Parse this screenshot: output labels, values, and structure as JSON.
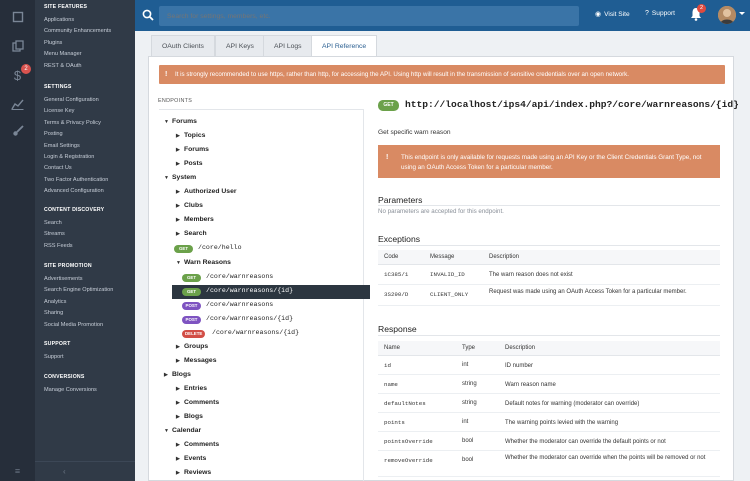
{
  "rail": {
    "icons": [
      "square-icon",
      "copy-icon",
      "dollar-icon",
      "chart-icon",
      "brush-icon"
    ],
    "badge": "2"
  },
  "menu": {
    "sections": [
      {
        "heading": "SITE FEATURES",
        "links": [
          "Applications",
          "Community Enhancements",
          "Plugins",
          "Menu Manager",
          "REST & OAuth"
        ]
      },
      {
        "heading": "SETTINGS",
        "links": [
          "General Configuration",
          "License Key",
          "Terms & Privacy Policy",
          "Posting",
          "Email Settings",
          "Login & Registration",
          "Contact Us",
          "Two Factor Authentication",
          "Advanced Configuration"
        ]
      },
      {
        "heading": "CONTENT DISCOVERY",
        "links": [
          "Search",
          "Streams",
          "RSS Feeds"
        ]
      },
      {
        "heading": "SITE PROMOTION",
        "links": [
          "Advertisements",
          "Search Engine Optimization",
          "Analytics",
          "Sharing",
          "Social Media Promotion"
        ]
      },
      {
        "heading": "SUPPORT",
        "links": [
          "Support"
        ]
      },
      {
        "heading": "CONVERSIONS",
        "links": [
          "Manage Conversions"
        ]
      }
    ]
  },
  "header": {
    "search_placeholder": "Search for settings, members, etc.",
    "visit_site": "Visit Site",
    "support": "Support",
    "notification_count": "2"
  },
  "tabs": [
    "OAuth Clients",
    "API Keys",
    "API Logs",
    "API Reference"
  ],
  "https_warning": "It is strongly recommended to use https, rather than http, for accessing the API. Using http will result in the transmission of sensitive credentials over an open network.",
  "endpoints": {
    "title": "ENDPOINTS",
    "tree": [
      {
        "label": "Forums",
        "level": 0,
        "open": true
      },
      {
        "label": "Topics",
        "level": 1
      },
      {
        "label": "Forums",
        "level": 1
      },
      {
        "label": "Posts",
        "level": 1
      },
      {
        "label": "System",
        "level": 0,
        "open": true
      },
      {
        "label": "Authorized User",
        "level": 1
      },
      {
        "label": "Clubs",
        "level": 1
      },
      {
        "label": "Members",
        "level": 1
      },
      {
        "label": "Search",
        "level": 1
      },
      {
        "method": "GET",
        "path": "/core/hello",
        "level": 1
      },
      {
        "label": "Warn Reasons",
        "level": 1,
        "open": true
      },
      {
        "method": "GET",
        "path": "/core/warnreasons",
        "level": 2
      },
      {
        "method": "GET",
        "path": "/core/warnreasons/{id}",
        "level": 2,
        "selected": true
      },
      {
        "method": "POST",
        "path": "/core/warnreasons",
        "level": 2
      },
      {
        "method": "POST",
        "path": "/core/warnreasons/{id}",
        "level": 2
      },
      {
        "method": "DELETE",
        "path": "/core/warnreasons/{id}",
        "level": 2
      },
      {
        "label": "Groups",
        "level": 1
      },
      {
        "label": "Messages",
        "level": 1
      },
      {
        "label": "Blogs",
        "level": 0
      },
      {
        "label": "Entries",
        "level": 1
      },
      {
        "label": "Comments",
        "level": 1
      },
      {
        "label": "Blogs",
        "level": 1
      },
      {
        "label": "Calendar",
        "level": 0,
        "open": true
      },
      {
        "label": "Comments",
        "level": 1
      },
      {
        "label": "Events",
        "level": 1
      },
      {
        "label": "Reviews",
        "level": 1
      }
    ]
  },
  "detail": {
    "method": "GET",
    "url": "http://localhost/ips4/api/index.php?/core/warnreasons/{id}",
    "description": "Get specific warn reason",
    "access_warning": "This endpoint is only available for requests made using an API Key or the Client Credentials Grant Type, not using an OAuth Access Token for a particular member.",
    "parameters_title": "Parameters",
    "parameters_empty": "No parameters are accepted for this endpoint.",
    "exceptions_title": "Exceptions",
    "exceptions_headers": [
      "Code",
      "Message",
      "Description"
    ],
    "exceptions": [
      [
        "1C385/1",
        "INVALID_ID",
        "The warn reason does not exist"
      ],
      [
        "3S290/D",
        "CLIENT_ONLY",
        "Request was made using an OAuth Access Token for a particular member."
      ]
    ],
    "response_title": "Response",
    "response_headers": [
      "Name",
      "Type",
      "Description"
    ],
    "response": [
      [
        "id",
        "int",
        "ID number"
      ],
      [
        "name",
        "string",
        "Warn reason name"
      ],
      [
        "defaultNotes",
        "string",
        "Default notes for warning (moderator can override)"
      ],
      [
        "points",
        "int",
        "The warning points levied with the warning"
      ],
      [
        "pointsOverride",
        "bool",
        "Whether the moderator can override the default points or not"
      ],
      [
        "removeOverride",
        "bool",
        "Whether the moderator can override when the points will be removed or not"
      ]
    ]
  },
  "colors": {
    "header": "#1f5d93",
    "sidebar": "#303a47",
    "rail": "#262e3a",
    "warning": "#d98a63",
    "get": "#6ba14a",
    "post": "#7e53c1",
    "delete": "#d24e46"
  }
}
